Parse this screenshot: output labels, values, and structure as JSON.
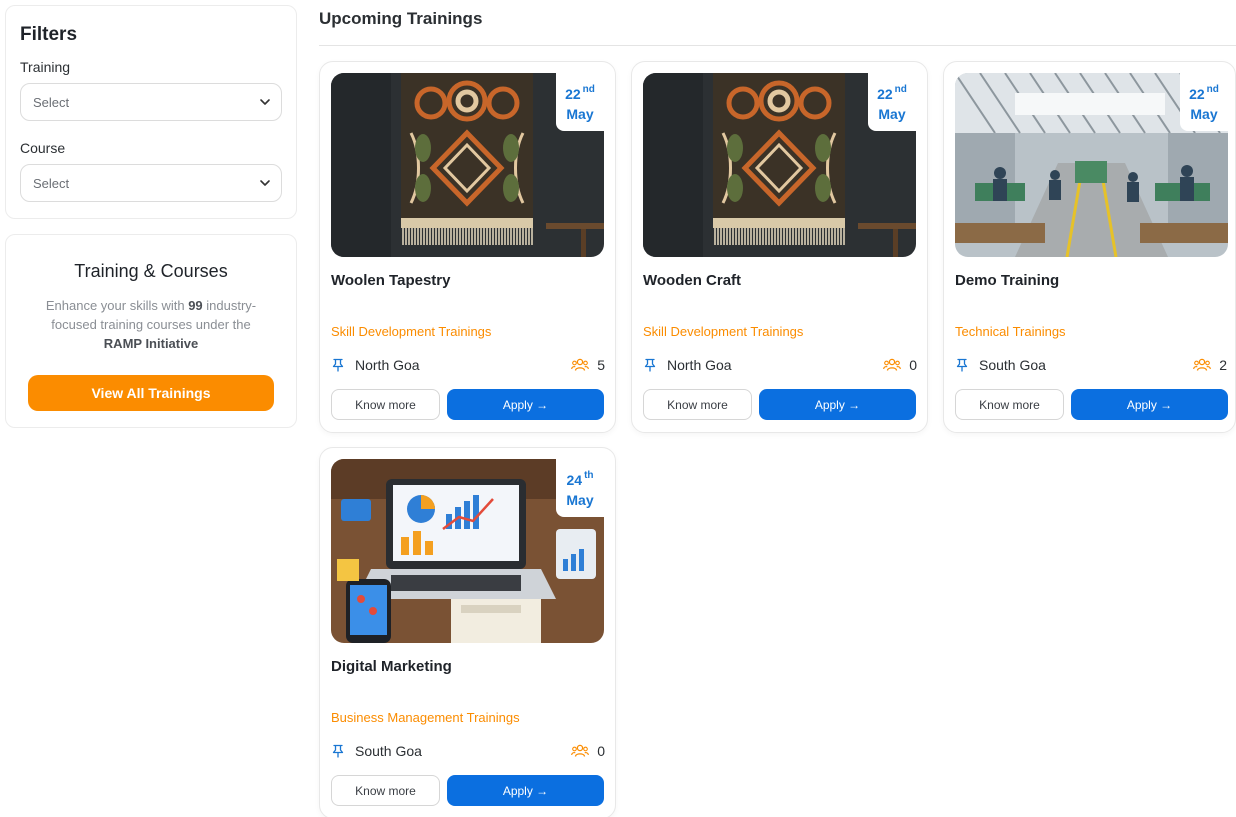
{
  "filters": {
    "title": "Filters",
    "training_label": "Training",
    "training_value": "Select",
    "course_label": "Course",
    "course_value": "Select"
  },
  "courses_panel": {
    "title": "Training & Courses",
    "desc_prefix": "Enhance your skills with ",
    "count": "99",
    "desc_middle": " industry-focused training courses under the ",
    "initiative": "RAMP Initiative",
    "button_label": "View All Trainings"
  },
  "main": {
    "section_title": "Upcoming Trainings",
    "know_more_label": "Know more",
    "apply_label": "Apply →",
    "trainings": [
      {
        "title": "Woolen Tapestry",
        "category": "Skill Development Trainings",
        "location": "North Goa",
        "count": "5",
        "day": "22",
        "suffix": "nd",
        "month": "May",
        "image": "tapestry"
      },
      {
        "title": "Wooden Craft",
        "category": "Skill Development Trainings",
        "location": "North Goa",
        "count": "0",
        "day": "22",
        "suffix": "nd",
        "month": "May",
        "image": "tapestry"
      },
      {
        "title": "Demo Training",
        "category": "Technical Trainings",
        "location": "South Goa",
        "count": "2",
        "day": "22",
        "suffix": "nd",
        "month": "May",
        "image": "workshop"
      },
      {
        "title": "Digital Marketing",
        "category": "Business Management Trainings",
        "location": "South Goa",
        "count": "0",
        "day": "24",
        "suffix": "th",
        "month": "May",
        "image": "marketing"
      }
    ]
  },
  "colors": {
    "accent_orange": "#fb8c00",
    "accent_blue": "#0b6fe0",
    "date_blue": "#1976d2"
  }
}
